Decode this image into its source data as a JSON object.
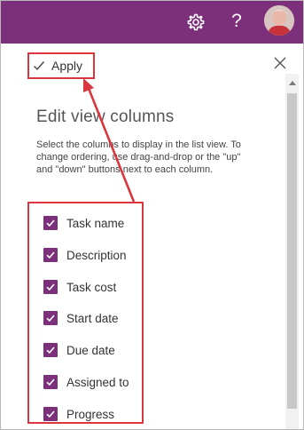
{
  "suitebar": {
    "color": "#7c2f7a",
    "icons": [
      "gear-icon",
      "help-icon",
      "avatar"
    ],
    "help_glyph": "?"
  },
  "panel": {
    "apply_label": "Apply",
    "close_icon": "close-icon",
    "heading": "Edit view columns",
    "description": "Select the columns to display in the list view. To change ordering, use drag-and-drop or the \"up\" and \"down\" buttons next to each column.",
    "columns": [
      {
        "label": "Task name",
        "checked": true
      },
      {
        "label": "Description",
        "checked": true
      },
      {
        "label": "Task cost",
        "checked": true
      },
      {
        "label": "Start date",
        "checked": true
      },
      {
        "label": "Due date",
        "checked": true
      },
      {
        "label": "Assigned to",
        "checked": true
      },
      {
        "label": "Progress",
        "checked": true
      }
    ]
  },
  "annotation": {
    "highlight_color": "#d9373f"
  }
}
